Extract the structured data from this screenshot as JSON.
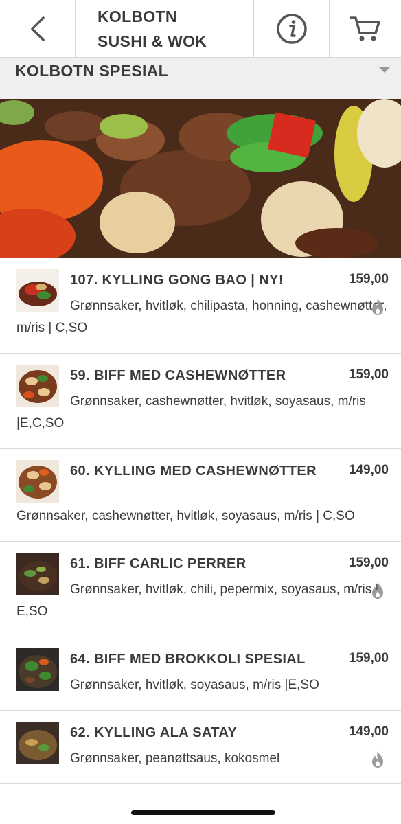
{
  "header": {
    "title_line1": "KOLBOTN",
    "title_line2": "SUSHI & WOK",
    "back_icon": "chevron-left-icon",
    "info_icon": "info-circle-icon",
    "cart_icon": "cart-icon"
  },
  "category": {
    "label": "KOLBOTN SPESIAL",
    "dropdown_icon": "caret-down-icon"
  },
  "menu": {
    "items": [
      {
        "name": "107. KYLLING GONG BAO | NY!",
        "price": "159,00",
        "desc": "Grønnsaker, hvitløk, chilipasta, honning, cashewnøtter, m/ris | C,SO",
        "spicy": true
      },
      {
        "name": "59. BIFF MED CASHEWNØTTER",
        "price": "159,00",
        "desc": "Grønnsaker, cashewnøtter, hvitløk, soyasaus, m/ris |E,C,SO",
        "spicy": false
      },
      {
        "name": "60. KYLLING MED CASHEWNØTTER",
        "price": "149,00",
        "desc": "Grønnsaker, cashewnøtter, hvitløk, soyasaus, m/ris | C,SO",
        "spicy": false
      },
      {
        "name": "61. BIFF CARLIC PERRER",
        "price": "159,00",
        "desc": "Grønnsaker, hvitløk, chili, pepermix, soyasaus, m/ris | E,SO",
        "spicy": true
      },
      {
        "name": "64. BIFF MED BROKKOLI SPESIAL",
        "price": "159,00",
        "desc": "Grønnsaker, hvitløk, soyasaus, m/ris |E,SO",
        "spicy": false
      },
      {
        "name": "62. KYLLING ALA SATAY",
        "price": "149,00",
        "desc": "Grønnsaker, peanøttsaus, kokosmel",
        "spicy": true
      }
    ]
  },
  "colors": {
    "text": "#3a3a3a",
    "divider": "#d9d9d9",
    "category_bg": "#efefef",
    "flame": "#9a9a9a"
  }
}
